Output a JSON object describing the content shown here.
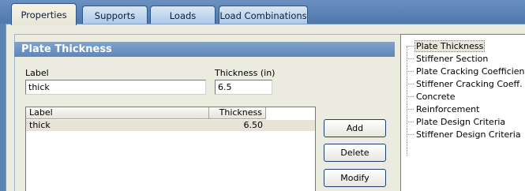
{
  "tabs": [
    {
      "label": "Properties",
      "active": true
    },
    {
      "label": "Supports",
      "active": false
    },
    {
      "label": "Loads",
      "active": false
    },
    {
      "label": "Load Combinations",
      "active": false
    }
  ],
  "section": {
    "title": "Plate Thickness"
  },
  "form": {
    "label_caption": "Label",
    "label_value": "thick",
    "thickness_caption": "Thickness (in)",
    "thickness_value": "6.5"
  },
  "list": {
    "columns": [
      "Label",
      "Thickness"
    ],
    "rows": [
      {
        "label": "thick",
        "thickness": "6.50"
      }
    ]
  },
  "buttons": {
    "add": "Add",
    "delete": "Delete",
    "modify": "Modify"
  },
  "tree": {
    "items": [
      "Plate Thickness",
      "Stiffener Section",
      "Plate Cracking Coefficient",
      "Stiffener Cracking Coeff.",
      "Concrete",
      "Reinforcement",
      "Plate Design Criteria",
      "Stiffener Design Criteria"
    ],
    "selected": "Plate Thickness"
  },
  "colors": {
    "tab_bar": "#5b84b6",
    "panel_bg": "#ecebe0",
    "header_bar": "#6f96c6",
    "selected_row": "#e7e4d7"
  }
}
